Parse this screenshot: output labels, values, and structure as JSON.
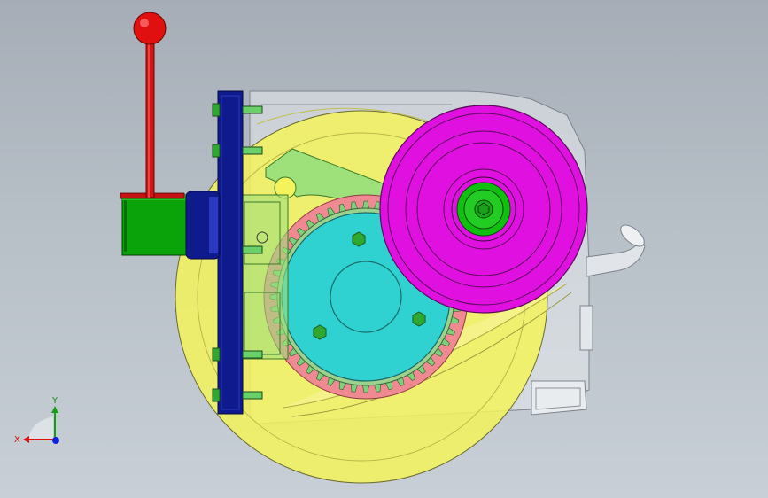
{
  "viewport": {
    "background_top": "#a6adb6",
    "background_bottom": "#c8cfd6"
  },
  "model": {
    "housing_color": "#e3e6ea",
    "casing_color": "#f4f35c",
    "lever_color": "#d01515",
    "knob_color": "#e01010",
    "handle_sleeve_color": "#0aa40a",
    "flange_color": "#0f1a8c",
    "ring_gear_color": "#f08a92",
    "pinion_color": "#60c8ff",
    "sun_gear_color": "#2fd2d0",
    "pulley_color": "#e010e0",
    "hub_color": "#10c010",
    "bracket_color": "#9ee07a",
    "bolt_color": "#2ea82e"
  },
  "triad": {
    "x_label": "X",
    "y_label": "Y",
    "x_color": "#e01010",
    "y_color": "#10a010",
    "z_color": "#1020e0"
  }
}
